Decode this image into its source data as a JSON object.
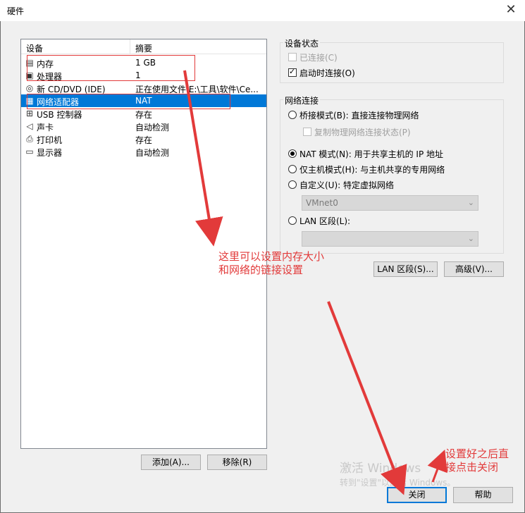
{
  "window": {
    "title": "硬件",
    "close_glyph": "✕"
  },
  "device_list": {
    "col_device": "设备",
    "col_summary": "摘要",
    "rows": [
      {
        "name": "内存",
        "summary": "1 GB",
        "icon": "memory-icon",
        "glyph": "▤"
      },
      {
        "name": "处理器",
        "summary": "1",
        "icon": "processor-icon",
        "glyph": "▣"
      },
      {
        "name": "新 CD/DVD (IDE)",
        "summary": "正在使用文件 E:\\工具\\软件\\Ce...",
        "icon": "cd-dvd-icon",
        "glyph": "◎"
      },
      {
        "name": "网络适配器",
        "summary": "NAT",
        "icon": "network-adapter-icon",
        "glyph": "▦"
      },
      {
        "name": "USB 控制器",
        "summary": "存在",
        "icon": "usb-icon",
        "glyph": "⊞"
      },
      {
        "name": "声卡",
        "summary": "自动检测",
        "icon": "speaker-icon",
        "glyph": "◁"
      },
      {
        "name": "打印机",
        "summary": "存在",
        "icon": "printer-icon",
        "glyph": "⎙"
      },
      {
        "name": "显示器",
        "summary": "自动检测",
        "icon": "monitor-icon",
        "glyph": "▭"
      }
    ],
    "selected_index": 3,
    "add_button": "添加(A)...",
    "remove_button": "移除(R)"
  },
  "device_status": {
    "title": "设备状态",
    "connected": "已连接(C)",
    "connect_on_power": "启动时连接(O)"
  },
  "network": {
    "title": "网络连接",
    "bridged": "桥接模式(B): 直接连接物理网络",
    "replicate": "复制物理网络连接状态(P)",
    "nat": "NAT 模式(N): 用于共享主机的 IP 地址",
    "host_only": "仅主机模式(H): 与主机共享的专用网络",
    "custom": "自定义(U): 特定虚拟网络",
    "custom_value": "VMnet0",
    "lan": "LAN 区段(L):",
    "lan_value": "",
    "lan_segments_button": "LAN 区段(S)...",
    "advanced_button": "高级(V)..."
  },
  "footer": {
    "close_button": "关闭",
    "help_button": "帮助"
  },
  "annotations": {
    "note1_line1": "这里可以设置内存大小",
    "note1_line2": "和网络的链接设置",
    "note2_line1": "设置好之后直",
    "note2_line2": "接点击关闭",
    "color": "#e23a3a"
  },
  "watermark": {
    "line1": "激活 Windows",
    "line2": "转到\"设置\"以激活 Windows。"
  }
}
